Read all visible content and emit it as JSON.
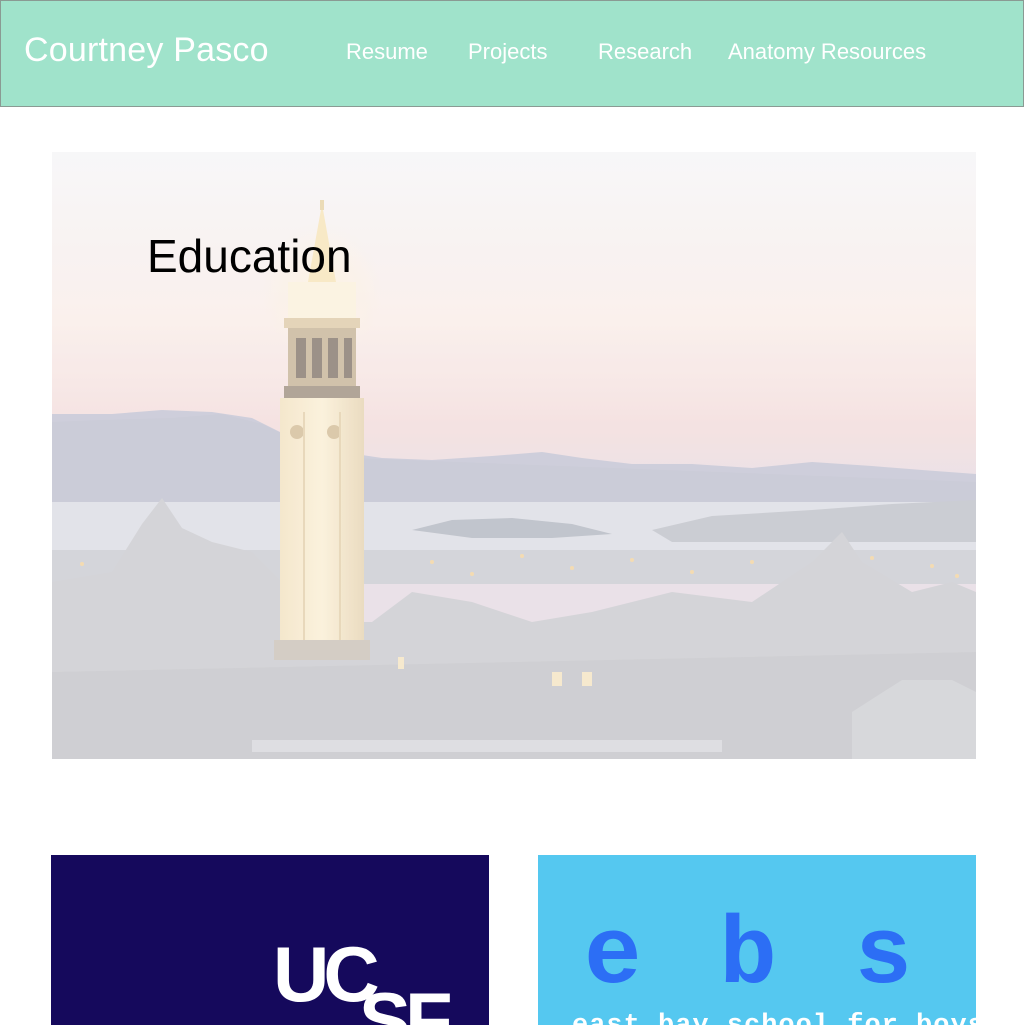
{
  "header": {
    "brand": "Courtney Pasco",
    "nav": [
      {
        "label": "Resume"
      },
      {
        "label": "Projects"
      },
      {
        "label": "Research"
      },
      {
        "label": "Anatomy Resources"
      }
    ]
  },
  "hero": {
    "title": "Education"
  },
  "cards": {
    "ucsf": {
      "logo_text": "UCSF"
    },
    "ebsb": {
      "letters": "e b s b",
      "tagline": "east bay school for boys"
    }
  },
  "colors": {
    "navbar_bg": "#a0e3cb",
    "ucsf_bg": "#15095c",
    "ebsb_bg": "#55c8f0",
    "ebsb_letters": "#2c6ef5"
  }
}
